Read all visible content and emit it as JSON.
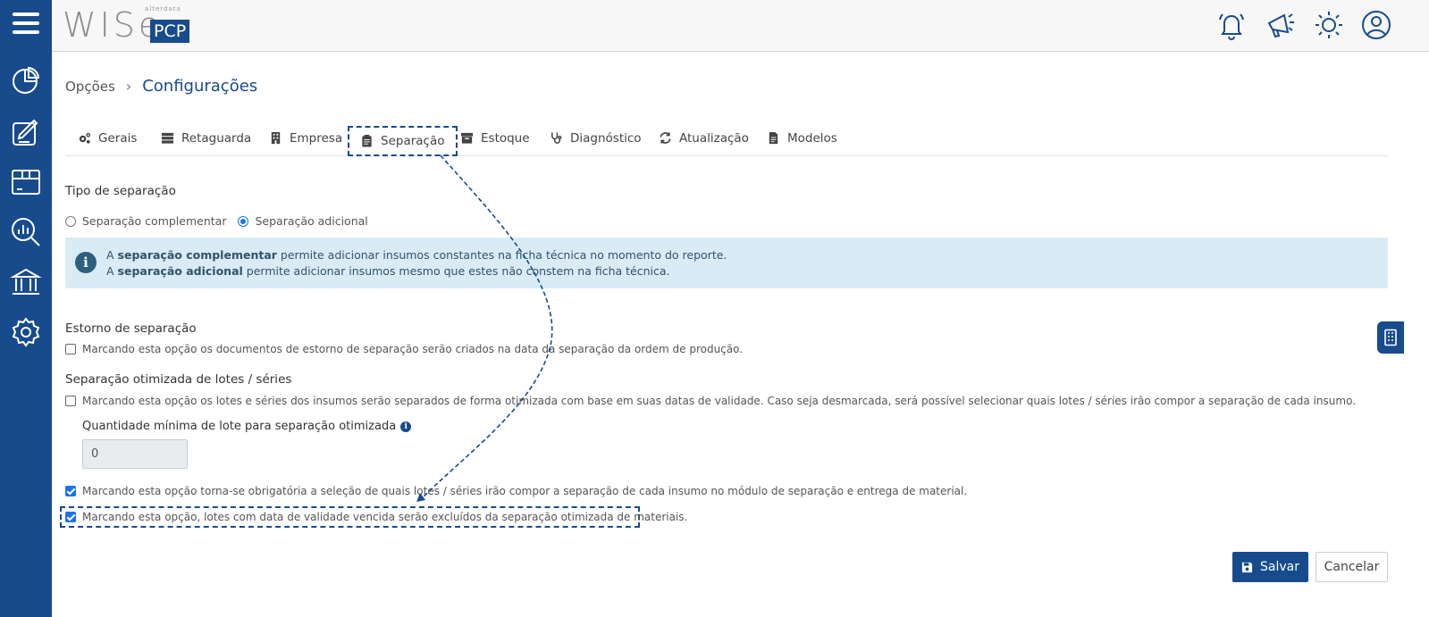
{
  "header": {
    "logo_word": "WISe",
    "logo_brand": "alterdata",
    "logo_badge": "PCP",
    "icons": [
      "bell-icon",
      "megaphone-icon",
      "sun-icon",
      "user-icon"
    ]
  },
  "sidebar": {
    "icons": [
      "hamburger-icon",
      "chart-pie-icon",
      "edit-note-icon",
      "box-icon",
      "report-search-icon",
      "bank-icon",
      "settings-icon"
    ]
  },
  "breadcrumb": {
    "parent": "Opções",
    "separator": "›",
    "current": "Configurações"
  },
  "tabs": [
    {
      "label": "Gerais",
      "icon": "cogs-icon"
    },
    {
      "label": "Retaguarda",
      "icon": "server-icon"
    },
    {
      "label": "Empresa",
      "icon": "building-icon"
    },
    {
      "label": "Separação",
      "icon": "clipboard-icon",
      "active": true
    },
    {
      "label": "Estoque",
      "icon": "archive-icon"
    },
    {
      "label": "Diagnóstico",
      "icon": "stethoscope-icon"
    },
    {
      "label": "Atualização",
      "icon": "sync-icon"
    },
    {
      "label": "Modelos",
      "icon": "file-icon"
    }
  ],
  "tipo": {
    "title": "Tipo de separação",
    "option1": "Separação complementar",
    "option2": "Separação adicional",
    "selected": "Separação adicional"
  },
  "info": {
    "l1_a": "A ",
    "l1_b": "separação complementar",
    "l1_c": " permite adicionar insumos constantes na ficha técnica no momento do reporte.",
    "l2_a": "A ",
    "l2_b": "separação adicional",
    "l2_c": " permite adicionar insumos mesmo que estes não constem na ficha técnica."
  },
  "estorno": {
    "title": "Estorno de separação",
    "check_label": "Marcando esta opção os documentos de estorno de separação serão criados na data da separação da ordem de produção.",
    "checked": false
  },
  "otimizada": {
    "title": "Separação otimizada de lotes / séries",
    "check_label": "Marcando esta opção os lotes e séries dos insumos serão separados de forma otimizada com base em suas datas de validade. Caso seja desmarcada, será possível selecionar quais lotes / séries irão compor a separação de cada insumo.",
    "checked": false,
    "qty_label": "Quantidade mínima de lote para separação otimizada",
    "qty_value": "0"
  },
  "obrigatoria": {
    "check_label": "Marcando esta opção torna-se obrigatória a seleção de quais lotes / séries irão compor a separação de cada insumo no módulo de separação e entrega de material.",
    "checked": true
  },
  "vencida": {
    "check_label": "Marcando esta opção, lotes com data de validade vencida serão excluídos da separação otimizada de materiais.",
    "checked": true
  },
  "actions": {
    "save": "Salvar",
    "cancel": "Cancelar"
  },
  "colors": {
    "primary": "#174b8c",
    "info_bg": "#d9ecf6",
    "checkbox_on": "#1a73e8"
  }
}
